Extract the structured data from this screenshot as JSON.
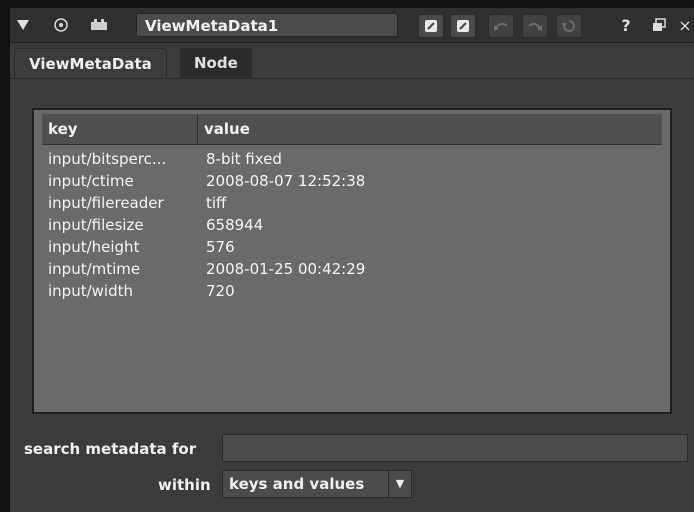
{
  "toolbar": {
    "node_name": "ViewMetaData1",
    "icons": [
      "collapse-triangle-icon",
      "eye-icon",
      "node-icon",
      "copy-icon",
      "paste-icon",
      "undo-icon",
      "redo-icon",
      "revert-icon",
      "help-icon",
      "float-icon",
      "close-icon"
    ],
    "help_glyph": "?",
    "close_glyph": "×"
  },
  "tabs": [
    {
      "label": "ViewMetaData",
      "active": true
    },
    {
      "label": "Node",
      "active": false
    }
  ],
  "table": {
    "headers": {
      "key": "key",
      "value": "value"
    },
    "rows": [
      {
        "key": "input/bitsperc...",
        "value": "8-bit fixed"
      },
      {
        "key": "input/ctime",
        "value": "2008-08-07 12:52:38"
      },
      {
        "key": "input/filereader",
        "value": "tiff"
      },
      {
        "key": "input/filesize",
        "value": "658944"
      },
      {
        "key": "input/height",
        "value": "576"
      },
      {
        "key": "input/mtime",
        "value": "2008-01-25 00:42:29"
      },
      {
        "key": "input/width",
        "value": "720"
      }
    ]
  },
  "search": {
    "label": "search metadata for",
    "value": "",
    "within_label": "within",
    "within_value": "keys and values"
  }
}
